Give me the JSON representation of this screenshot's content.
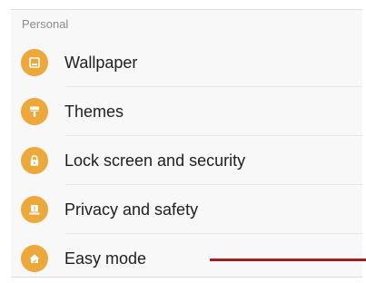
{
  "section": {
    "title": "Personal"
  },
  "colors": {
    "icon_bg": "#eda83c",
    "pointer_line": "#a31d23"
  },
  "items": [
    {
      "label": "Wallpaper",
      "icon": "wallpaper-icon"
    },
    {
      "label": "Themes",
      "icon": "themes-brush-icon"
    },
    {
      "label": "Lock screen and security",
      "icon": "lock-icon"
    },
    {
      "label": "Privacy and safety",
      "icon": "privacy-safety-icon"
    },
    {
      "label": "Easy mode",
      "icon": "easy-mode-home-icon"
    }
  ]
}
